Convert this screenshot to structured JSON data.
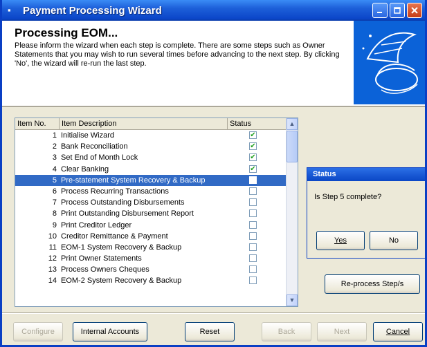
{
  "window": {
    "title": "Payment Processing Wizard"
  },
  "header": {
    "title": "Processing EOM...",
    "text": "Please inform the wizard when each step is complete. There are some steps such as Owner Statements that you may wish to run several times before advancing to the next step. By clicking 'No', the wizard will re-run the last step."
  },
  "list": {
    "columns": [
      "Item No.",
      "Item Description",
      "Status"
    ],
    "rows": [
      {
        "no": "1",
        "desc": "Initialise Wizard",
        "status": "✔"
      },
      {
        "no": "2",
        "desc": "Bank Reconciliation",
        "status": "✔"
      },
      {
        "no": "3",
        "desc": "Set End of Month Lock",
        "status": "✔"
      },
      {
        "no": "4",
        "desc": "Clear Banking",
        "status": "✔"
      },
      {
        "no": "5",
        "desc": "Pre-statement System Recovery & Backup",
        "status": ""
      },
      {
        "no": "6",
        "desc": "Process Recurring Transactions",
        "status": ""
      },
      {
        "no": "7",
        "desc": "Process Outstanding Disbursements",
        "status": ""
      },
      {
        "no": "8",
        "desc": "Print Outstanding Disbursement Report",
        "status": ""
      },
      {
        "no": "9",
        "desc": "Print Creditor Ledger",
        "status": ""
      },
      {
        "no": "10",
        "desc": "Creditor Remittance & Payment",
        "status": ""
      },
      {
        "no": "11",
        "desc": "EOM-1 System Recovery & Backup",
        "status": ""
      },
      {
        "no": "12",
        "desc": "Print Owner Statements",
        "status": ""
      },
      {
        "no": "13",
        "desc": "Process Owners Cheques",
        "status": ""
      },
      {
        "no": "14",
        "desc": "EOM-2 System Recovery & Backup",
        "status": ""
      }
    ]
  },
  "dialog": {
    "title": "Status",
    "message": "Is Step 5 complete?",
    "yes": "Yes",
    "no": "No"
  },
  "buttons": {
    "reprocess": "Re-process Step/s",
    "configure": "Configure",
    "internal_accounts": "Internal Accounts",
    "reset": "Reset",
    "back": "Back",
    "next": "Next",
    "cancel": "Cancel"
  }
}
